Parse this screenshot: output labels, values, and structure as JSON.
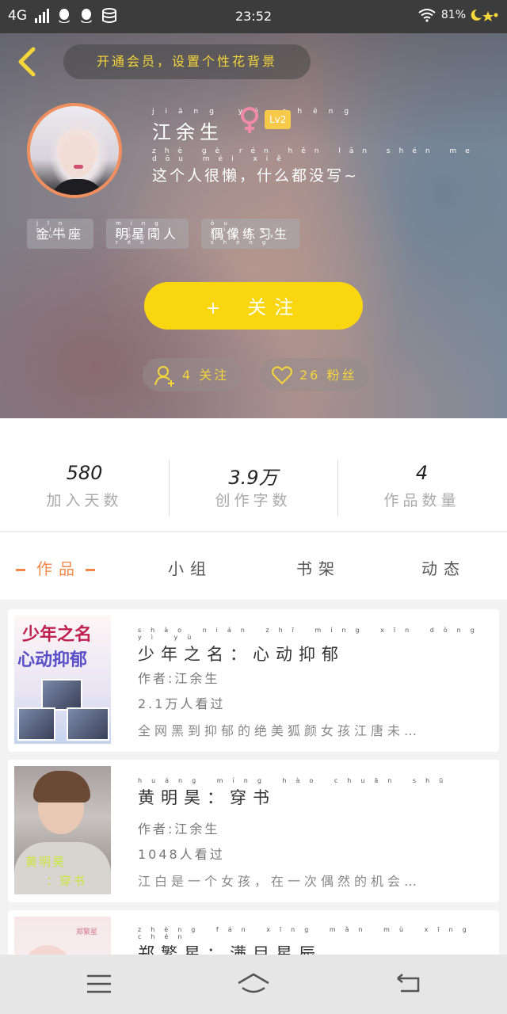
{
  "status_bar": {
    "network": "4G",
    "time": "23:52",
    "battery": "81%"
  },
  "header": {
    "back_icon": "chevron-left-icon",
    "tip": "开通会员，设置个性花背景"
  },
  "profile": {
    "name": "江余生",
    "name_pinyin": "jiāng yú shēng",
    "gender_icon": "female-icon",
    "level": "Lv2",
    "bio": "这个人很懒，什么都没写~",
    "bio_pinyin": "zhè gè rén hěn lǎn shén me dōu méi xiě",
    "tags": [
      {
        "label": "金牛座",
        "pinyin": "jīn niú zuò"
      },
      {
        "label": "明星同人",
        "pinyin": "míng xīng tóng rén"
      },
      {
        "label": "偶像练习生",
        "pinyin": "ǒu xiàng liàn xí shēng"
      }
    ],
    "follow_button": "关注",
    "follow_pinyin": "guān zhù",
    "following_label": "4 关注",
    "fans_label": "26 粉丝"
  },
  "stats": [
    {
      "value": "580",
      "label": "加入天数",
      "pinyin": "jiā rù tiān shù"
    },
    {
      "value": "3.9万",
      "label": "创作字数",
      "pinyin": "chuàng zuò zì shù"
    },
    {
      "value": "4",
      "label": "作品数量",
      "pinyin": "zuò pǐn shù liàng"
    }
  ],
  "tabs": [
    {
      "label": "作品",
      "pinyin": "zuò pǐn",
      "active": true
    },
    {
      "label": "小组",
      "pinyin": "xiǎo zǔ",
      "active": false
    },
    {
      "label": "书架",
      "pinyin": "shū jià",
      "active": false
    },
    {
      "label": "动态",
      "pinyin": "dòng tài",
      "active": false
    }
  ],
  "works": [
    {
      "title": "少年之名：心动抑郁",
      "title_pinyin": "shào nián zhī míng xīn dòng yì yù",
      "author": "作者:江余生",
      "views": "2.1万人看过",
      "desc": "全网黑到抑郁的绝美狐颜女孩江唐未…",
      "cover_text": [
        "少年之名",
        "心动抑郁"
      ]
    },
    {
      "title": "黄明昊：穿书",
      "title_pinyin": "huáng míng hào chuān shū",
      "author": "作者:江余生",
      "views": "1048人看过",
      "desc": "江白是一个女孩，在一次偶然的机会…",
      "cover_text": [
        "黄明昊",
        "：穿书"
      ]
    },
    {
      "title": "郑繁星：满目星辰",
      "title_pinyin": "zhèng fán xīng mǎn mù xīng chén",
      "cover_text": [
        "郑繁星"
      ]
    }
  ],
  "nav": {
    "menu_icon": "menu-icon",
    "home_icon": "home-icon",
    "back_icon": "back-icon"
  },
  "colors": {
    "accent": "#f9d60f",
    "tab_active": "#f08a4b",
    "gender": "#f08aa8"
  }
}
